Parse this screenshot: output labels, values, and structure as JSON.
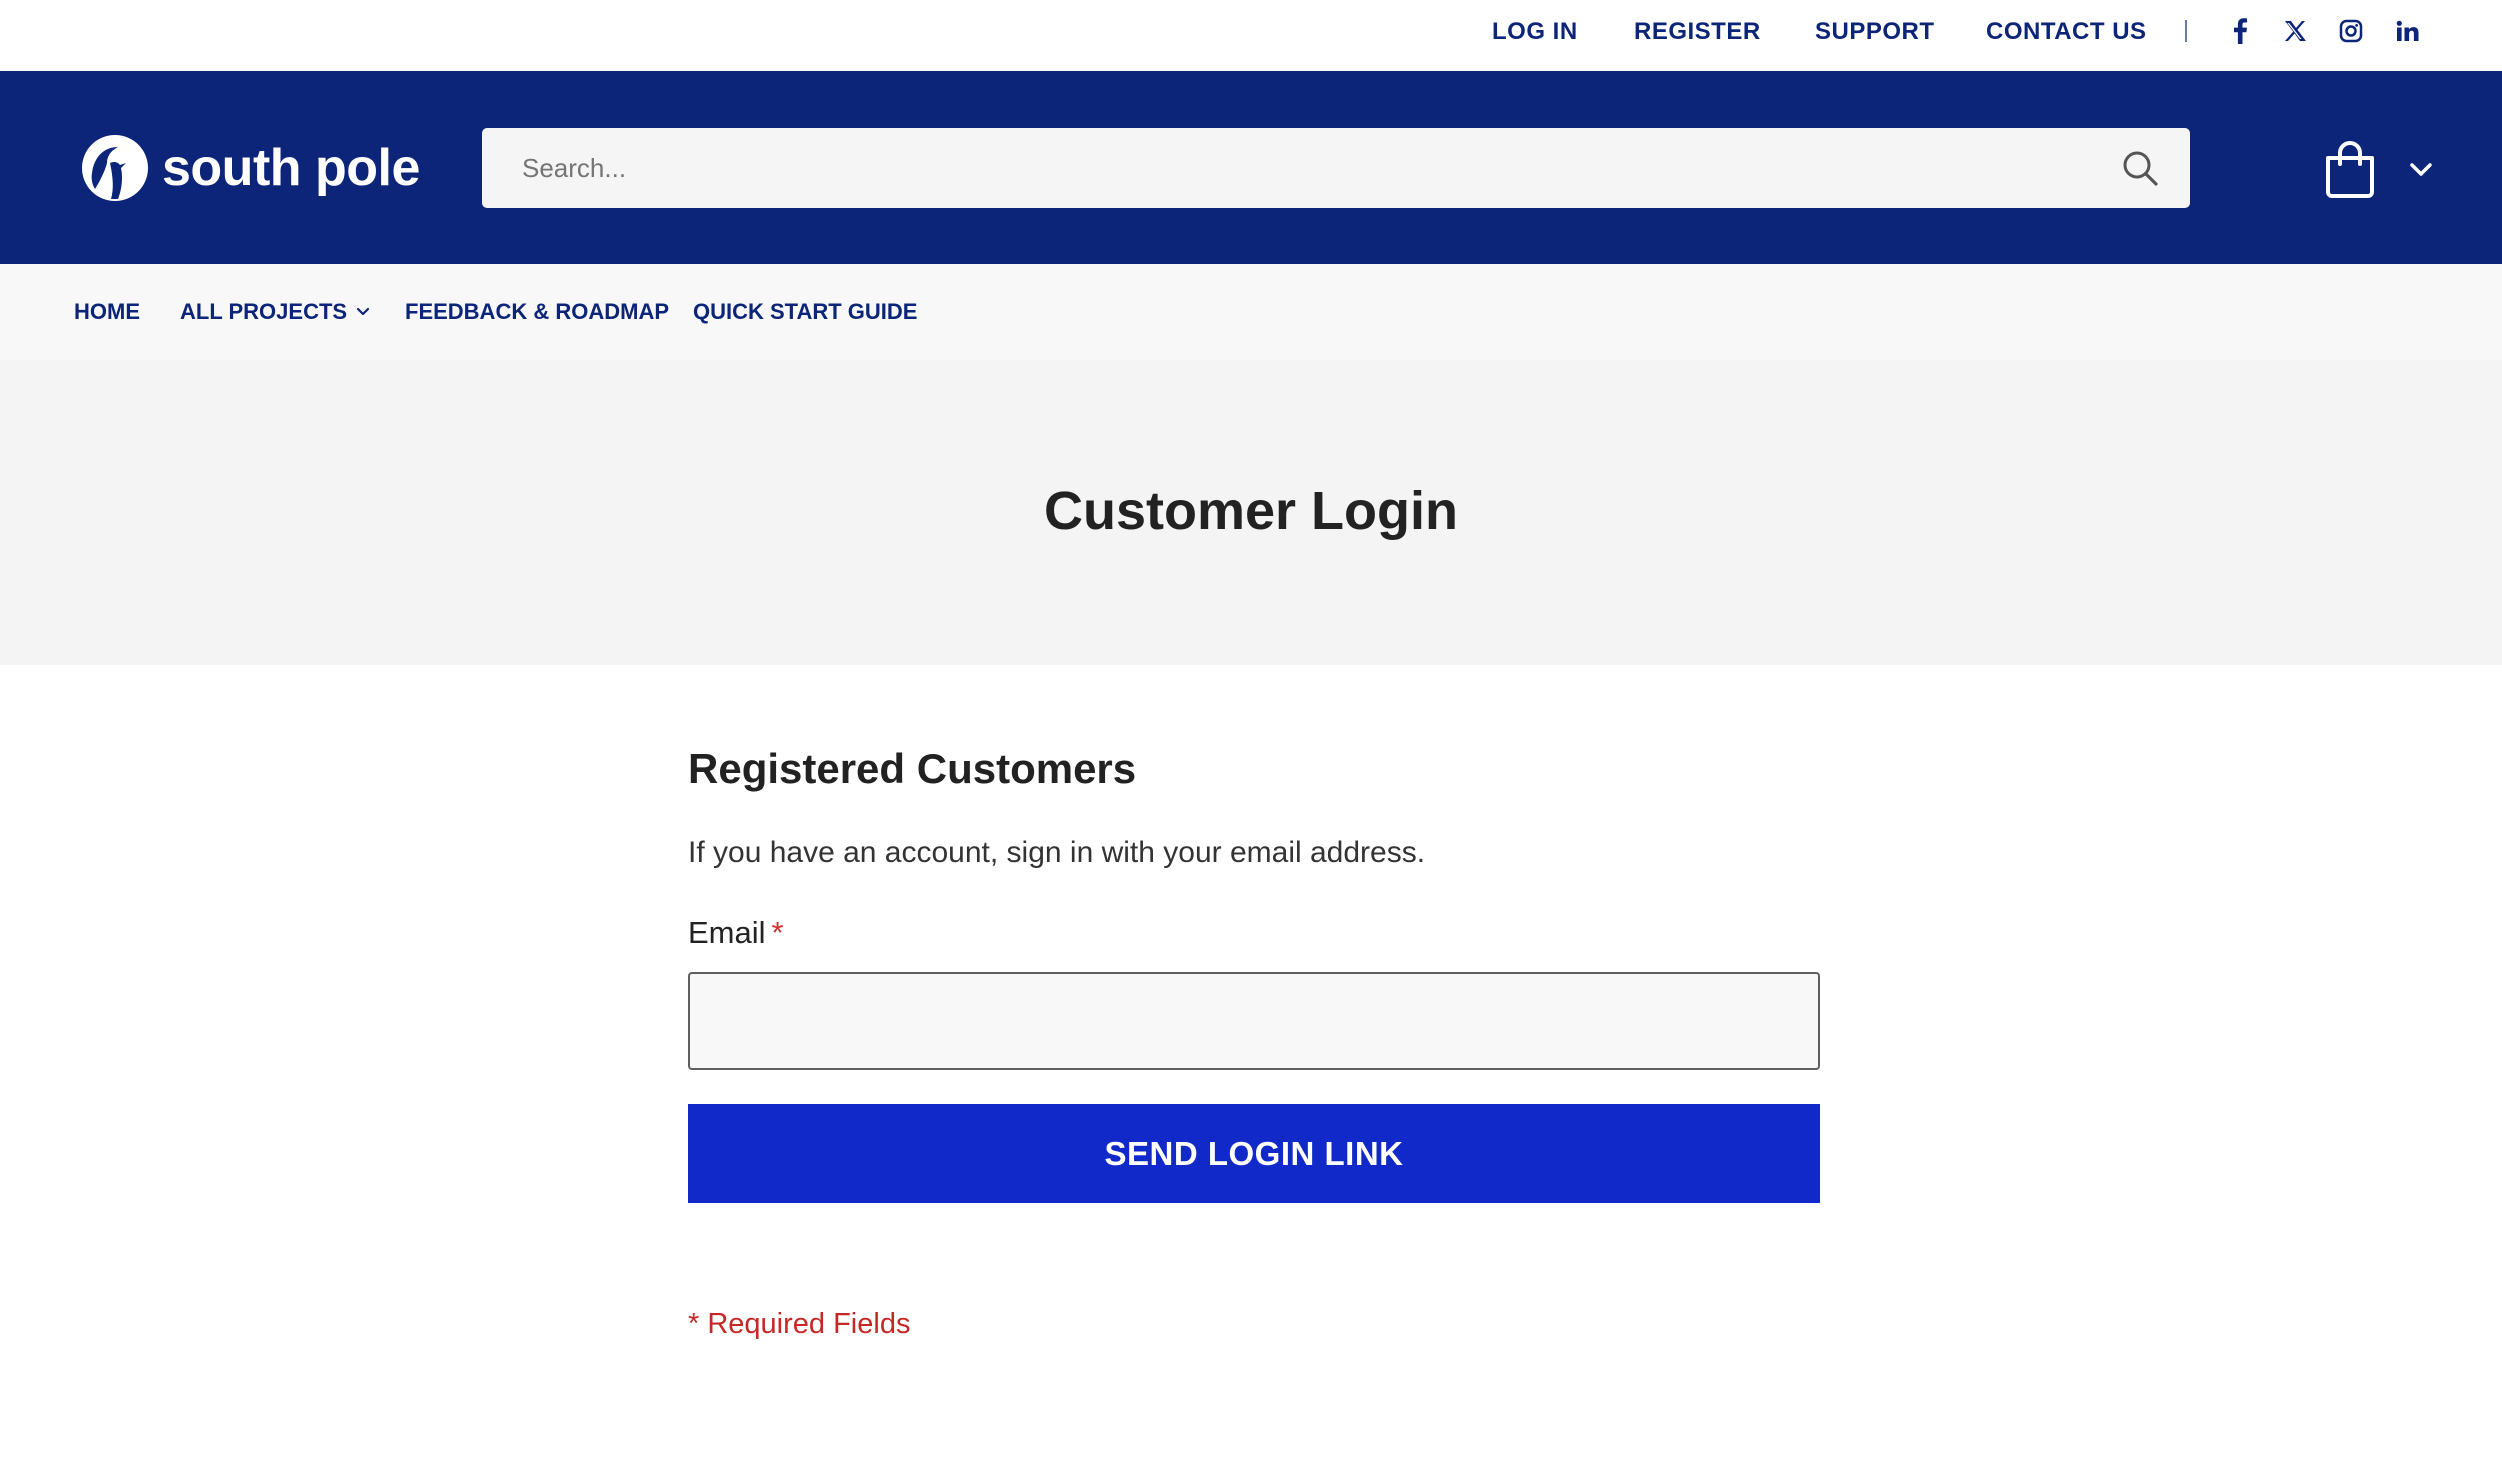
{
  "topbar": {
    "links": [
      "LOG IN",
      "REGISTER",
      "SUPPORT",
      "CONTACT US"
    ],
    "social": [
      "facebook-icon",
      "x-icon",
      "instagram-icon",
      "linkedin-icon"
    ]
  },
  "header": {
    "logo_text": "south pole",
    "search_placeholder": "Search...",
    "cart_icon": "shopping-bag-icon"
  },
  "nav": {
    "items": [
      "HOME",
      "ALL PROJECTS",
      "FEEDBACK & ROADMAP",
      "QUICK START GUIDE"
    ]
  },
  "page": {
    "title": "Customer Login"
  },
  "form": {
    "title": "Registered Customers",
    "intro": "If you have an account, sign in with your email address.",
    "email_label": "Email",
    "required_marker": "*",
    "email_value": "",
    "submit_label": "SEND LOGIN LINK",
    "required_note": "* Required Fields"
  },
  "colors": {
    "brand_navy": "#0d2579",
    "button_blue": "#1029c8",
    "required_red": "#d32f2f"
  }
}
